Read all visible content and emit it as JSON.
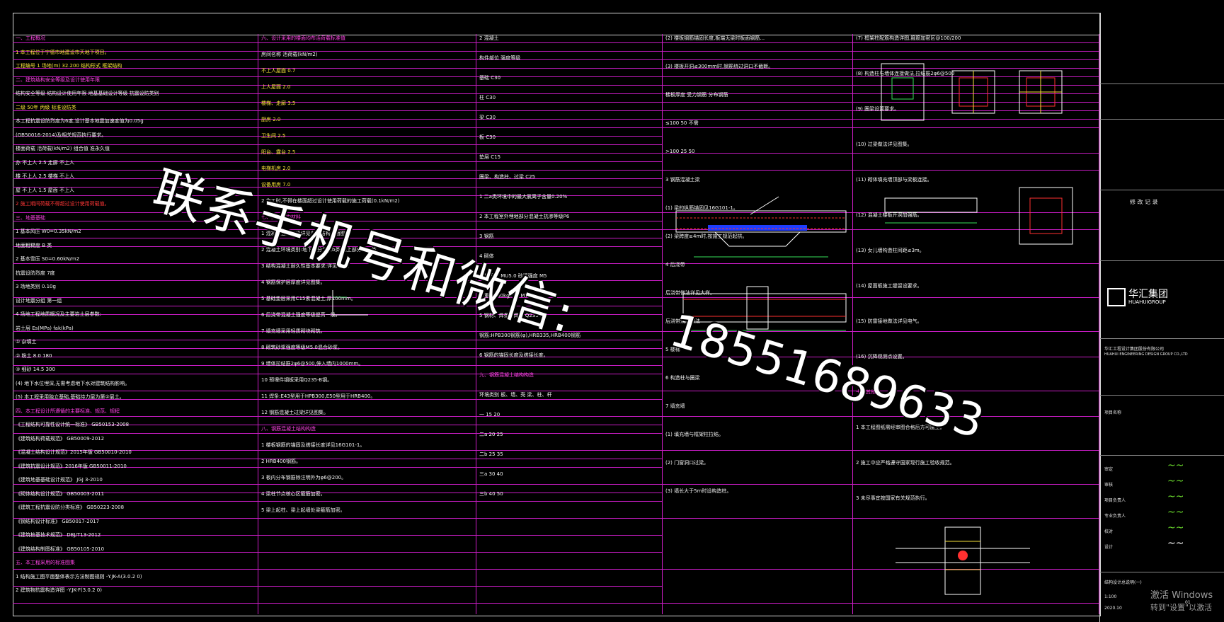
{
  "watermark": {
    "line1": "联系手机号和微信:",
    "line2": "18551689633"
  },
  "col1": {
    "items": [
      {
        "t": "一、工程概况",
        "c": "mag"
      },
      {
        "t": "1   本工程位于宁德市地建设市天地下项目。",
        "c": "yel"
      },
      {
        "t": "  工程编号    1         场地(m)      32.200     结构形式         框架结构",
        "c": "yel"
      },
      {
        "t": "二、建筑结构安全等级及设计使用年限",
        "c": "mag"
      },
      {
        "t": "  结构安全等级     结构设计使用年限    地基基础设计等级    抗震设防类别",
        "c": ""
      },
      {
        "t": "     二级                50年           丙级            标准设防类",
        "c": "yel"
      },
      {
        "t": "  本工程抗震设防烈度为6度,设计基本地震加速度值为0.05g",
        "c": ""
      },
      {
        "t": "  (GB50016-2014)及相关规范执行要求。",
        "c": ""
      },
      {
        "t": "  楼面荷载   活荷载(kN/m2)   组合值   准永久值",
        "c": ""
      },
      {
        "t": "  办        不上人     2.5      走廊      不上人",
        "c": ""
      },
      {
        "t": "  楼        不上人     2.5      楼梯      不上人",
        "c": ""
      },
      {
        "t": "  屋        不上人     1.5      屋面      不上人",
        "c": ""
      },
      {
        "t": "2  施工期间荷载不得超过设计使用荷载值。",
        "c": "red"
      },
      {
        "t": "三、地基基础",
        "c": "mag"
      },
      {
        "t": "1    基本风压  W0=0.35kN/m2",
        "c": ""
      },
      {
        "t": "     地面粗糙度     B 类",
        "c": ""
      },
      {
        "t": "2    基本雪压     S0=0.60kN/m2",
        "c": ""
      },
      {
        "t": "     抗震设防烈度     7度",
        "c": ""
      },
      {
        "t": "3    场地类别          0.10g",
        "c": ""
      },
      {
        "t": "     设计地震分组       第一组",
        "c": ""
      },
      {
        "t": "4    场地工程地质概况及主要岩土层参数:",
        "c": ""
      },
      {
        "t": "     岩土层       Es(MPa)      fak(kPa)",
        "c": ""
      },
      {
        "t": "     ① 杂填土",
        "c": ""
      },
      {
        "t": "     ② 粉土              8.0           180",
        "c": ""
      },
      {
        "t": "     ③ 细砂              14.5          300",
        "c": ""
      },
      {
        "t": "(4) 地下水位埋深,无需考虑地下水对建筑结构影响。",
        "c": ""
      },
      {
        "t": "(5) 本工程采用独立基础,基础持力层为第②层土。",
        "c": ""
      },
      {
        "t": "四、本工程设计所遵循的主要标准、规范、规程",
        "c": "mag"
      },
      {
        "t": "  《工程结构可靠性设计统一标准》      GB50153-2008",
        "c": ""
      },
      {
        "t": "  《建筑结构荷载规范》                GB50009-2012",
        "c": ""
      },
      {
        "t": "  《混凝土结构设计规范》2015年版      GB50010-2010",
        "c": ""
      },
      {
        "t": "  《建筑抗震设计规范》2016年版        GB50011-2010",
        "c": ""
      },
      {
        "t": "  《建筑地基基础设计规范》            JGJ 3-2010",
        "c": ""
      },
      {
        "t": "  《砌体结构设计规范》                GB50003-2011",
        "c": ""
      },
      {
        "t": "  《建筑工程抗震设防分类标准》        GB50223-2008",
        "c": ""
      },
      {
        "t": "  《钢结构设计标准》                  GB50017-2017",
        "c": ""
      },
      {
        "t": "  《建筑桩基技术规范》                DBJ/T13-2012",
        "c": ""
      },
      {
        "t": "  《建筑结构制图标准》                GB50105-2010",
        "c": ""
      },
      {
        "t": "五、本工程采用的标准图集",
        "c": "mag"
      },
      {
        "t": "1  结构施工图平面整体表示方法制图规则  -Y.JK-A(3.0.2 0)",
        "c": ""
      },
      {
        "t": "2  建筑物抗震构造详图  -Y.JK-F(3.0.2 0)",
        "c": ""
      }
    ]
  },
  "col2": {
    "items": [
      {
        "t": "六、设计采用的楼面均布活荷载标准值",
        "c": "mag"
      },
      {
        "t": "  房间名称         活荷载(kN/m2)",
        "c": ""
      },
      {
        "t": "  不上人屋面             0.7",
        "c": "yel"
      },
      {
        "t": "  上人屋面               2.0",
        "c": "yel"
      },
      {
        "t": "  楼梯、走廊             3.5",
        "c": "yel"
      },
      {
        "t": "  厨房                   2.0",
        "c": "yel"
      },
      {
        "t": "  卫生间                 2.5",
        "c": "yel"
      },
      {
        "t": "  阳台、露台             2.5",
        "c": "yel"
      },
      {
        "t": "  电梯机房               2.0",
        "c": "yel"
      },
      {
        "t": "  设备用房               7.0",
        "c": "yel"
      },
      {
        "t": "2  施工时,不得在楼面超过设计使用荷载的施工荷载(0.1kN/m2)",
        "c": ""
      },
      {
        "t": "七、主要结构材料",
        "c": "mag"
      },
      {
        "t": "1  混凝土强度等级详见各层结构平面图。",
        "c": ""
      },
      {
        "t": "2  混凝土环境类别:地下部分为二b类,地上部分为一类。",
        "c": ""
      },
      {
        "t": "3  结构混凝土耐久性基本要求:详见下表。",
        "c": ""
      },
      {
        "t": "4  钢筋保护层厚度详见图集。",
        "c": ""
      },
      {
        "t": "5  基础垫层采用C15素混凝土,厚100mm。",
        "c": ""
      },
      {
        "t": "6  后浇带混凝土强度等级提高一级。",
        "c": ""
      },
      {
        "t": "7  填充墙采用轻质砌块砌筑。",
        "c": ""
      },
      {
        "t": "8  砌筑砂浆强度等级M5.0混合砂浆。",
        "c": ""
      },
      {
        "t": "9  墙体拉结筋2φ6@500,伸入墙内1000mm。",
        "c": ""
      },
      {
        "t": "10 预埋件钢板采用Q235-B钢。",
        "c": ""
      },
      {
        "t": "11 焊条:E43型用于HPB300,E50型用于HRB400。",
        "c": ""
      },
      {
        "t": "12 钢筋混凝土过梁详见图集。",
        "c": ""
      },
      {
        "t": "八、钢筋混凝土结构构造",
        "c": "mag"
      },
      {
        "t": "1  楼板钢筋的锚固及搭接长度详见16G101-1。",
        "c": ""
      },
      {
        "t": "2  HRB400钢筋。",
        "c": ""
      },
      {
        "t": "3  板内分布钢筋除注明外为φ6@200。",
        "c": ""
      },
      {
        "t": "4  梁柱节点核心区箍筋加密。",
        "c": ""
      },
      {
        "t": "5  梁上起柱、梁上起墙处梁箍筋加密。",
        "c": ""
      }
    ]
  },
  "col3": {
    "items": [
      {
        "t": "2  混凝土",
        "c": ""
      },
      {
        "t": "   构件部位                    强度等级",
        "c": ""
      },
      {
        "t": "   基础                          C30",
        "c": ""
      },
      {
        "t": "   柱                            C30",
        "c": ""
      },
      {
        "t": "   梁                            C30",
        "c": ""
      },
      {
        "t": "   板                            C30",
        "c": ""
      },
      {
        "t": "   垫层                          C15",
        "c": ""
      },
      {
        "t": "   圈梁、构造柱、过梁            C25",
        "c": ""
      },
      {
        "t": "1  二a类环境中的最大氯离子含量0.20%",
        "c": ""
      },
      {
        "t": "2  本工程室外埋地部分混凝土抗渗等级P6",
        "c": ""
      },
      {
        "t": "3  钢筋",
        "c": ""
      },
      {
        "t": "4  砌体",
        "c": ""
      },
      {
        "t": "   砌块强度  MU5.0     砂浆强度  M5",
        "c": ""
      },
      {
        "t": "   容重      1100kg/m3          M7.5",
        "c": ""
      },
      {
        "t": "5  钢材、焊条、焊剂     Q235-B",
        "c": ""
      },
      {
        "t": "   钢筋:HPB300钢筋(φ),HRB335,HRB400钢筋",
        "c": ""
      },
      {
        "t": "6  钢筋的锚固长度及搭接长度。",
        "c": ""
      },
      {
        "t": "九、钢筋混凝土结构构造",
        "c": "mag"
      },
      {
        "t": "   环境类别   板、墙、壳    梁、柱、杆",
        "c": ""
      },
      {
        "t": "     一          15             20",
        "c": ""
      },
      {
        "t": "     二a         20             25",
        "c": ""
      },
      {
        "t": "     二b         25             35",
        "c": ""
      },
      {
        "t": "     三a         30             40",
        "c": ""
      },
      {
        "t": "     三b         40             50",
        "c": ""
      }
    ]
  },
  "col4": {
    "items": [
      {
        "t": "(2) 楼板钢筋锚固长度,板端无梁时板面钢筋...",
        "c": ""
      },
      {
        "t": "(3) 楼板开洞≤300mm时,钢筋绕过洞口不截断。",
        "c": ""
      },
      {
        "t": "      楼板厚度     受力钢筋      分布钢筋",
        "c": ""
      },
      {
        "t": "      ≤100          50             不需",
        "c": ""
      },
      {
        "t": "      >100          25             50",
        "c": ""
      },
      {
        "t": "3  钢筋混凝土梁",
        "c": ""
      },
      {
        "t": "(1) 梁的纵筋锚固见16G101-1。",
        "c": ""
      },
      {
        "t": "(2) 梁跨度≥4m时,按施工规范起拱。",
        "c": ""
      },
      {
        "t": "4  后浇带",
        "c": ""
      },
      {
        "t": "   后浇带做法详见大样。",
        "c": ""
      },
      {
        "t": "   后浇带浇注做法",
        "c": ""
      },
      {
        "t": "5  楼梯",
        "c": ""
      },
      {
        "t": "6  构造柱与圈梁",
        "c": ""
      },
      {
        "t": "7  填充墙",
        "c": ""
      },
      {
        "t": "(1) 填充墙与框架柱拉结。",
        "c": ""
      },
      {
        "t": "(2) 门窗洞口过梁。",
        "c": ""
      },
      {
        "t": "(3) 墙长大于5m时设构造柱。",
        "c": ""
      }
    ]
  },
  "col5": {
    "items": [
      {
        "t": "(7) 框架柱配筋构造详图,箍筋加密区@100/200",
        "c": ""
      },
      {
        "t": "(8) 构造柱与墙体连接做法,拉结筋2φ6@500",
        "c": ""
      },
      {
        "t": "(9) 圈梁设置要求。",
        "c": ""
      },
      {
        "t": "(10) 过梁做法详见图集。",
        "c": ""
      },
      {
        "t": "(11) 砌体填充墙顶部与梁板连接。",
        "c": ""
      },
      {
        "t": "(12) 混凝土楼板开洞加强筋。",
        "c": ""
      },
      {
        "t": "(13) 女儿墙构造柱间距≤3m。",
        "c": ""
      },
      {
        "t": "(14) 屋面板施工缝留设要求。",
        "c": ""
      },
      {
        "t": "(15) 防雷接地做法详见电气。",
        "c": ""
      },
      {
        "t": "(16) 沉降观测点设置。",
        "c": ""
      },
      {
        "t": "十、其他",
        "c": "mag"
      },
      {
        "t": "1  本工程图纸需经审图合格后方可施工。",
        "c": ""
      },
      {
        "t": "2  施工中应严格遵守国家现行施工验收规范。",
        "c": ""
      },
      {
        "t": "3  未尽事宜按国家有关规范执行。",
        "c": ""
      }
    ]
  },
  "titleblock": {
    "company_logo_text": "华汇集团",
    "company_logo_en": "HUAHUIGROUP",
    "company_name": "华汇工程设计集团股份有限公司",
    "company_name_en": "HUAHUI ENGINEERING DESIGN GROUP CO.,LTD",
    "project": "项目名称",
    "drawing_title": "结构设计总说明(一)",
    "date": "2020.10",
    "sheet_no": "01",
    "scale": "1:100",
    "rows": [
      "审定",
      "审核",
      "项目负责人",
      "专业负责人",
      "校对",
      "设计"
    ],
    "change_note": "修 改 记 录"
  },
  "os_overlay": {
    "line1": "激活 Windows",
    "line2": "转到\"设置\"以激活"
  }
}
